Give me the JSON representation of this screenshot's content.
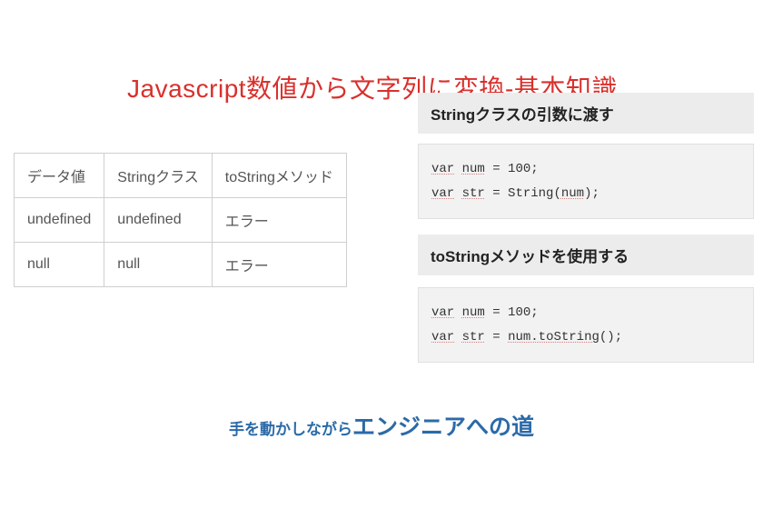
{
  "title": "Javascript数値から文字列に変換-基本知識",
  "table": {
    "headers": [
      "データ値",
      "Stringクラス",
      "toStringメソッド"
    ],
    "rows": [
      [
        "undefined",
        "undefined",
        "エラー"
      ],
      [
        "null",
        "null",
        "エラー"
      ]
    ]
  },
  "section1": {
    "heading": "Stringクラスの引数に渡す",
    "code": {
      "line1_kw": "var",
      "line1_ident": "num",
      "line1_rest": " = 100;",
      "line2_kw": "var",
      "line2_ident": "str",
      "line2_rest_a": " = String(",
      "line2_ident2": "num",
      "line2_rest_b": ");"
    }
  },
  "section2": {
    "heading": "toStringメソッドを使用する",
    "code": {
      "line1_kw": "var",
      "line1_ident": "num",
      "line1_rest": " = 100;",
      "line2_kw": "var",
      "line2_ident": "str",
      "line2_rest_a": " = ",
      "line2_ident2": "num.toString",
      "line2_rest_b": "();"
    }
  },
  "footer": {
    "small": "手を動かしながら",
    "big": "エンジニアへの道"
  }
}
